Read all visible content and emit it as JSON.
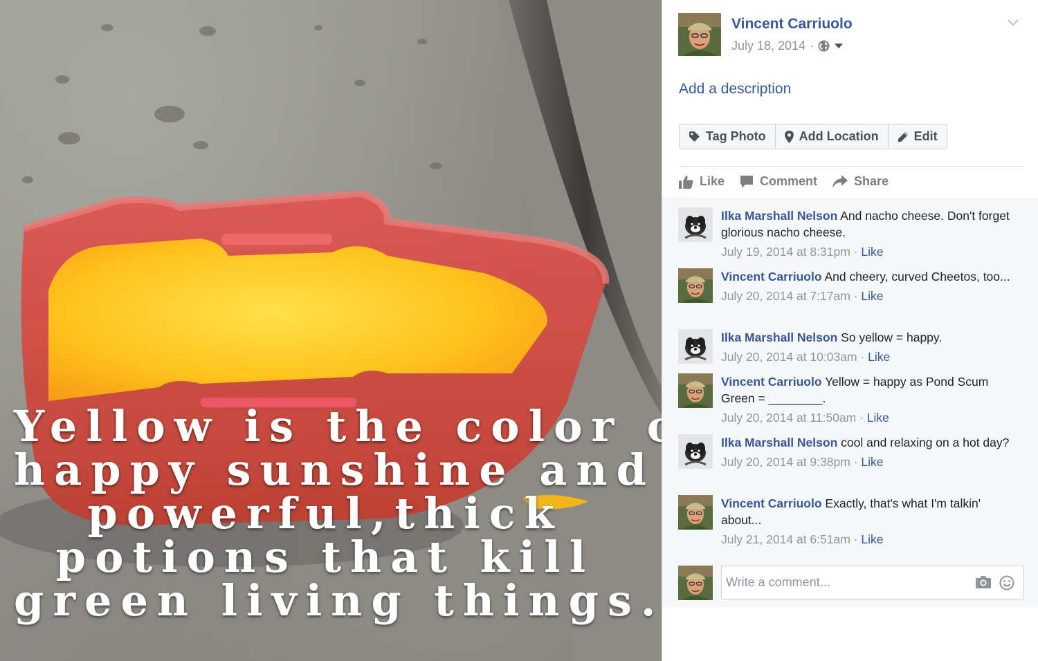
{
  "photo": {
    "caption_lines": [
      "Yellow is the color of",
      "happy sunshine and",
      "powerful,thick",
      "potions that kill",
      "green living things."
    ]
  },
  "post": {
    "author": "Vincent Carriuolo",
    "date": "July 18, 2014",
    "date_separator": "·",
    "privacy_icon": "globe-icon",
    "add_description": "Add a description",
    "actions": [
      {
        "label": "Tag Photo",
        "icon": "tag-icon"
      },
      {
        "label": "Add Location",
        "icon": "location-pin-icon"
      },
      {
        "label": "Edit",
        "icon": "pencil-icon"
      }
    ],
    "ufi": {
      "like": "Like",
      "comment": "Comment",
      "share": "Share"
    }
  },
  "comments": [
    {
      "author": "Ilka Marshall Nelson",
      "avatar": "dog",
      "text": "And nacho cheese. Don't forget glorious nacho cheese.",
      "time": "July 19, 2014 at 8:31pm",
      "like": "Like"
    },
    {
      "author": "Vincent Carriuolo",
      "avatar": "man",
      "text": "And cheery, curved Cheetos, too...",
      "time": "July 20, 2014 at 7:17am",
      "like": "Like"
    },
    {
      "author": "Ilka Marshall Nelson",
      "avatar": "dog",
      "text": "So yellow = happy.",
      "time": "July 20, 2014 at 10:03am",
      "like": "Like"
    },
    {
      "author": "Vincent Carriuolo",
      "avatar": "man",
      "text": "Yellow = happy as Pond Scum Green = ________.",
      "time": "July 20, 2014 at 11:50am",
      "like": "Like"
    },
    {
      "author": "Ilka Marshall Nelson",
      "avatar": "dog",
      "text": "cool and relaxing on a hot day?",
      "time": "July 20, 2014 at 9:38pm",
      "like": "Like"
    },
    {
      "author": "Vincent Carriuolo",
      "avatar": "man",
      "text": "Exactly, that's what I'm talkin' about...",
      "time": "July 21, 2014 at 6:51am",
      "like": "Like"
    }
  ],
  "composer": {
    "placeholder": "Write a comment..."
  },
  "colors": {
    "link": "#365899",
    "muted": "#90949c",
    "panel_bg": "#f6f7f9"
  }
}
